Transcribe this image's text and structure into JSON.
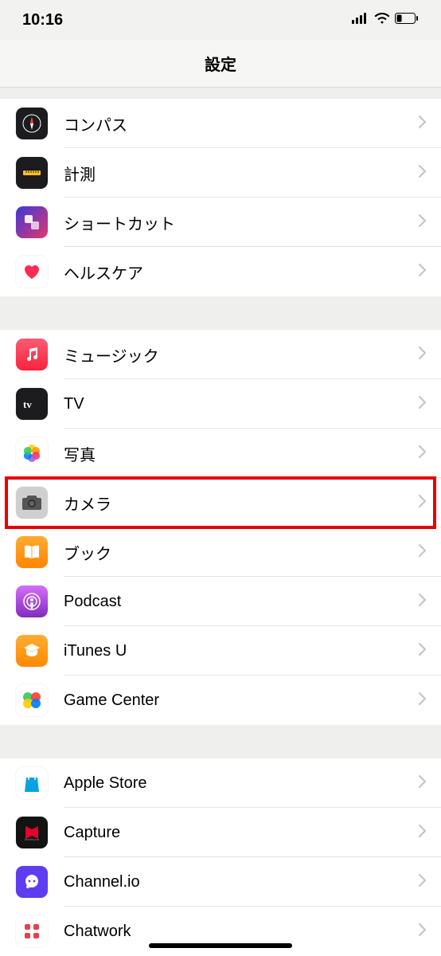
{
  "status": {
    "time": "10:16"
  },
  "header": {
    "title": "設定"
  },
  "groups": [
    {
      "rows": [
        {
          "id": "compass",
          "label": "コンパス",
          "icon": "compass-icon",
          "bg": "#1c1c1e"
        },
        {
          "id": "measure",
          "label": "計測",
          "icon": "measure-icon",
          "bg": "#1c1c1e"
        },
        {
          "id": "shortcuts",
          "label": "ショートカット",
          "icon": "shortcuts-icon",
          "bg": "linear-gradient(135deg,#3a39d8,#e3366f)"
        },
        {
          "id": "health",
          "label": "ヘルスケア",
          "icon": "health-icon",
          "bg": "#ffffff"
        }
      ]
    },
    {
      "rows": [
        {
          "id": "music",
          "label": "ミュージック",
          "icon": "music-icon",
          "bg": "linear-gradient(180deg,#fb5b74,#fa233b)"
        },
        {
          "id": "tv",
          "label": "TV",
          "icon": "tv-icon",
          "bg": "#1c1c1e"
        },
        {
          "id": "photos",
          "label": "写真",
          "icon": "photos-icon",
          "bg": "#ffffff"
        },
        {
          "id": "camera",
          "label": "カメラ",
          "icon": "camera-icon",
          "bg": "#cfcfcf",
          "highlighted": true
        },
        {
          "id": "books",
          "label": "ブック",
          "icon": "books-icon",
          "bg": "linear-gradient(180deg,#ffab33,#ff8500)"
        },
        {
          "id": "podcast",
          "label": "Podcast",
          "icon": "podcast-icon",
          "bg": "linear-gradient(180deg,#d56dfb,#822cbe)"
        },
        {
          "id": "itunesu",
          "label": "iTunes U",
          "icon": "itunesu-icon",
          "bg": "linear-gradient(180deg,#ffac33,#ff8a00)"
        },
        {
          "id": "gamecenter",
          "label": "Game Center",
          "icon": "gamecenter-icon",
          "bg": "#ffffff"
        }
      ]
    },
    {
      "rows": [
        {
          "id": "applestore",
          "label": "Apple Store",
          "icon": "applestore-icon",
          "bg": "#ffffff"
        },
        {
          "id": "capture",
          "label": "Capture",
          "icon": "capture-icon",
          "bg": "#131313"
        },
        {
          "id": "channelio",
          "label": "Channel.io",
          "icon": "channelio-icon",
          "bg": "#5e3cef"
        },
        {
          "id": "chatwork",
          "label": "Chatwork",
          "icon": "chatwork-icon",
          "bg": "#ffffff"
        }
      ]
    }
  ]
}
